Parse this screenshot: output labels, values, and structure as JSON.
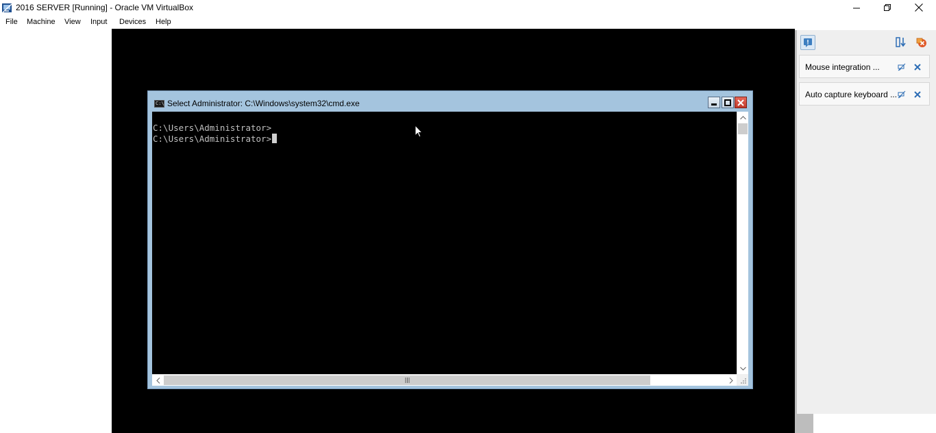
{
  "window": {
    "title": "2016 SERVER [Running] - Oracle VM VirtualBox",
    "icon": "virtualbox-app-icon"
  },
  "menubar": {
    "items": [
      "File",
      "Machine",
      "View",
      "Input",
      "Devices",
      "Help"
    ]
  },
  "cmd": {
    "title": "Select Administrator: C:\\Windows\\system32\\cmd.exe",
    "lines": [
      "C:\\Users\\Administrator>",
      "C:\\Users\\Administrator>"
    ]
  },
  "notifications": {
    "items": [
      {
        "text": "Mouse integration ..."
      },
      {
        "text": "Auto capture keyboard ..."
      }
    ]
  },
  "colors": {
    "console_bg": "#000000",
    "console_fg": "#c0c0c0",
    "cmd_frame": "#a4c4de",
    "panel_bg": "#efefef",
    "close_red": "#c23a2b"
  }
}
